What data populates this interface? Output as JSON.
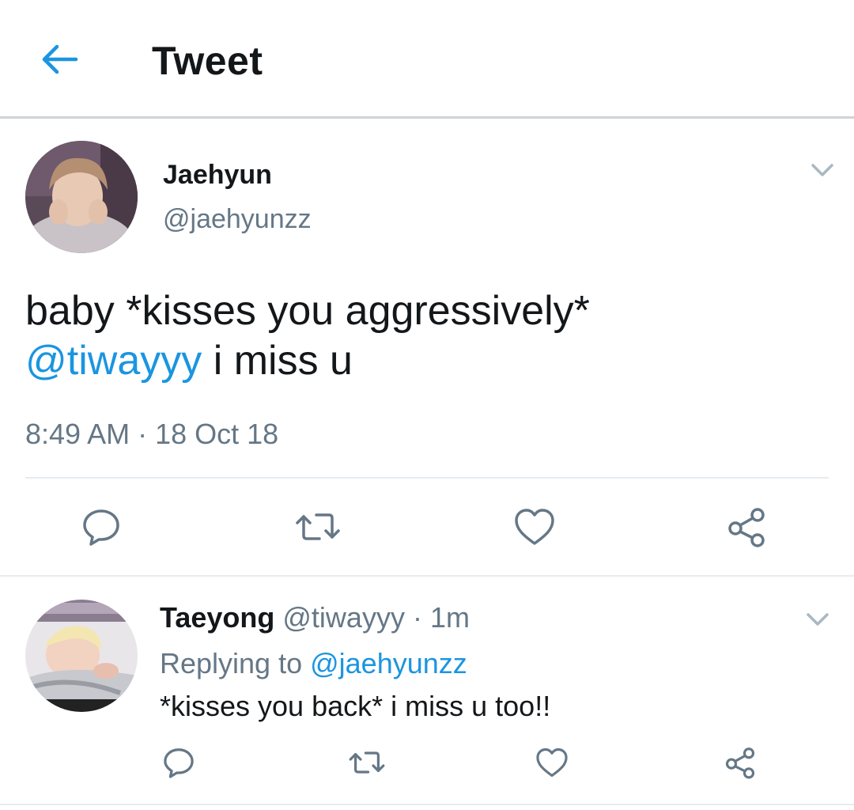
{
  "header": {
    "title": "Tweet",
    "back_icon": "arrow-left-icon",
    "accent_color": "#1b95e0"
  },
  "tweet": {
    "display_name": "Jaehyun",
    "handle": "@jaehyunzz",
    "text_line1": "baby *kisses you aggressively*",
    "mention": "@tiwayyy",
    "text_line2_rest": " i miss u",
    "timestamp": "8:49 AM · 18 Oct 18",
    "actions": [
      "reply-icon",
      "retweet-icon",
      "like-icon",
      "share-icon"
    ]
  },
  "reply": {
    "display_name": "Taeyong",
    "handle": "@tiwayyy",
    "separator": " · ",
    "age": "1m",
    "replying_to_label": "Replying to ",
    "replying_to_handle": "@jaehyunzz",
    "text": "*kisses you back* i miss u too!!",
    "actions": [
      "reply-icon",
      "retweet-icon",
      "like-icon",
      "share-icon"
    ]
  },
  "colors": {
    "text_primary": "#14171a",
    "text_secondary": "#657786",
    "link": "#1b95e0",
    "divider": "#e6ecf0"
  }
}
